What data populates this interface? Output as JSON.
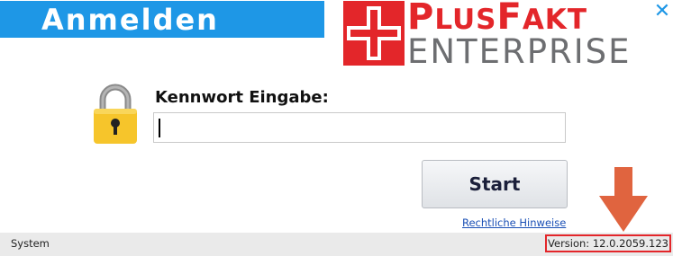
{
  "window": {
    "title": "Anmelden",
    "close_label": "✕"
  },
  "logo": {
    "line1_P": "P",
    "line1_rest1": "LUS",
    "line1_F": "F",
    "line1_rest2": "AKT",
    "line2": "ENTERPRISE"
  },
  "login": {
    "password_label": "Kennwort Eingabe:",
    "password_value": "",
    "start_label": "Start",
    "legal_link": "Rechtliche Hinweise"
  },
  "status": {
    "system": "System",
    "version": "Version: 12.0.2059.123"
  },
  "icons": {
    "lock": "padlock-icon",
    "arrow": "down-arrow-icon",
    "close": "close-icon",
    "logo": "plusfakt-cross-icon"
  },
  "colors": {
    "accent_blue": "#1e97e6",
    "brand_red": "#e3262a",
    "brand_gray": "#6d6e71",
    "arrow_orange": "#e0643f",
    "lock_yellow": "#f6c52b"
  }
}
